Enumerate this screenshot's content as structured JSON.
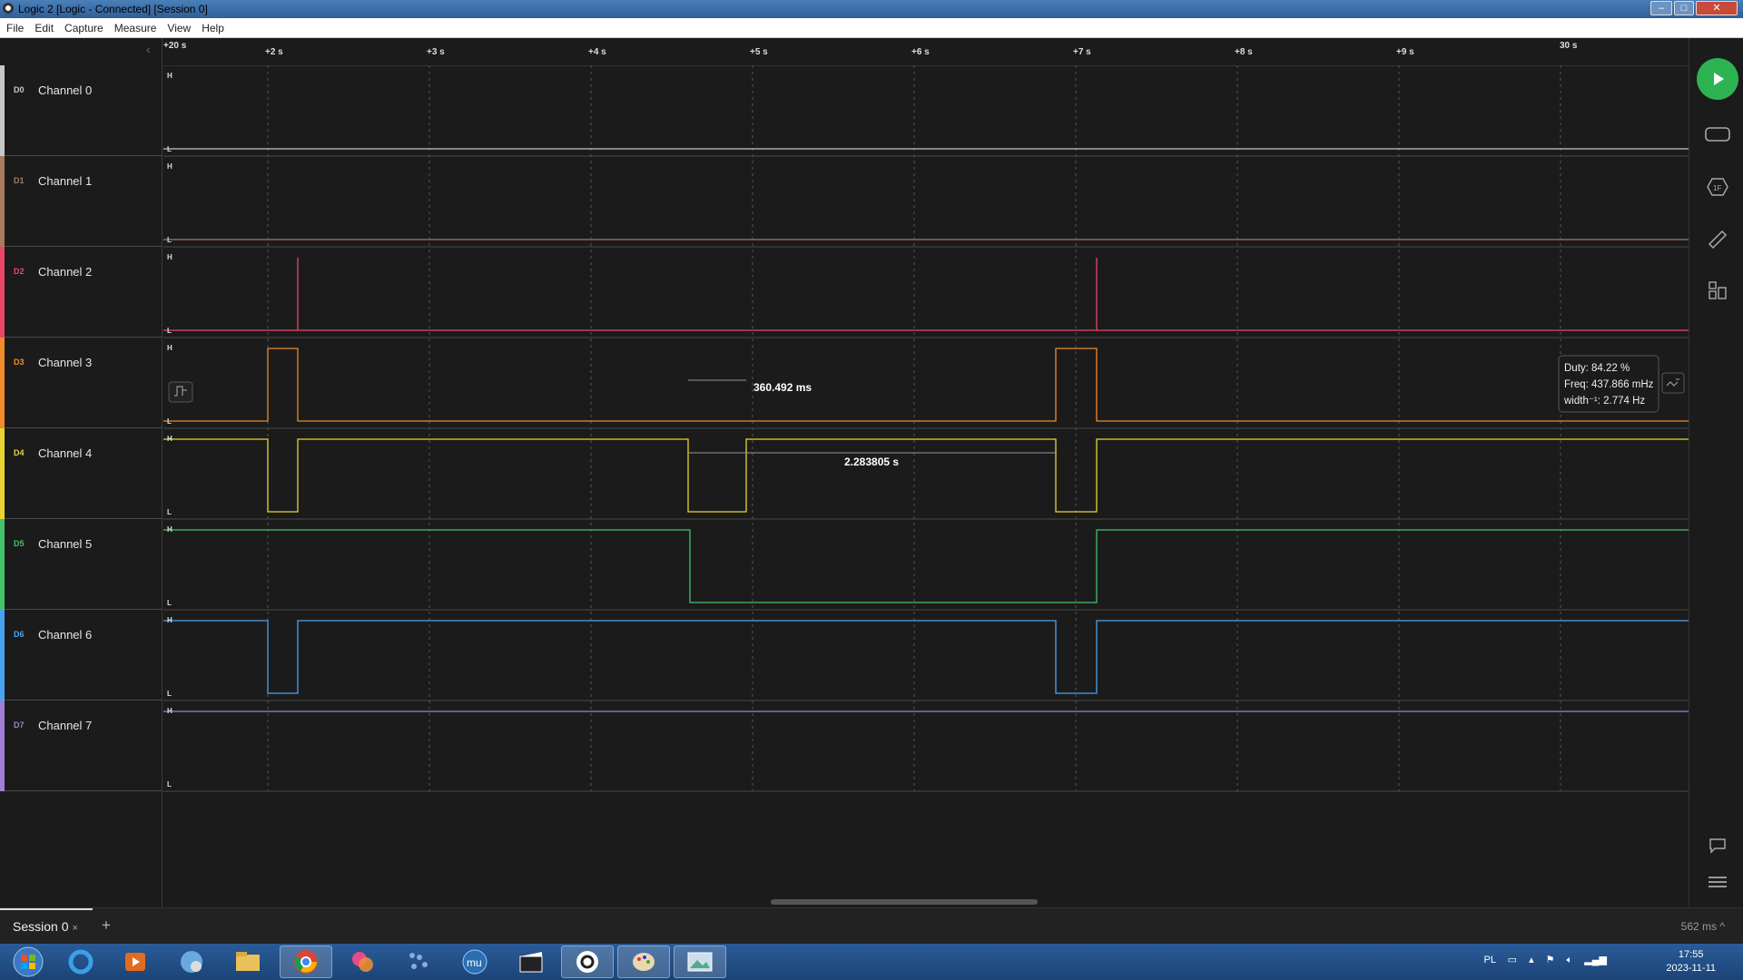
{
  "window": {
    "title": "Logic 2 [Logic - Connected] [Session 0]"
  },
  "menu": [
    "File",
    "Edit",
    "Capture",
    "Measure",
    "View",
    "Help"
  ],
  "ruler": {
    "start_label": "+20 s",
    "ticks": [
      "+2 s",
      "+3 s",
      "+4 s",
      "+5 s",
      "+6 s",
      "+7 s",
      "+8 s",
      "+9 s"
    ],
    "end_label": "30 s"
  },
  "channels": [
    {
      "id": "D0",
      "name": "Channel 0",
      "color": "#c8c8c8"
    },
    {
      "id": "D1",
      "name": "Channel 1",
      "color": "#a97a5e"
    },
    {
      "id": "D2",
      "name": "Channel 2",
      "color": "#e8476a"
    },
    {
      "id": "D3",
      "name": "Channel 3",
      "color": "#f08a2a"
    },
    {
      "id": "D4",
      "name": "Channel 4",
      "color": "#e8d532"
    },
    {
      "id": "D5",
      "name": "Channel 5",
      "color": "#44c26a"
    },
    {
      "id": "D6",
      "name": "Channel 6",
      "color": "#4aa3f0"
    },
    {
      "id": "D7",
      "name": "Channel 7",
      "color": "#9f7fd6"
    }
  ],
  "level_labels": {
    "high": "H",
    "low": "L"
  },
  "measurements": {
    "pulse_width": "360.492 ms",
    "period": "2.283805 s",
    "tooltip": {
      "duty": "Duty: 84.22 %",
      "freq": "Freq: 437.866 mHz",
      "width": "width⁻¹: 2.774 Hz"
    }
  },
  "session": {
    "tab_label": "Session 0",
    "close": "×",
    "add": "+",
    "zoom": "562 ms"
  },
  "taskbar": {
    "lang": "PL",
    "time": "17:55",
    "date": "2023-11-11"
  }
}
